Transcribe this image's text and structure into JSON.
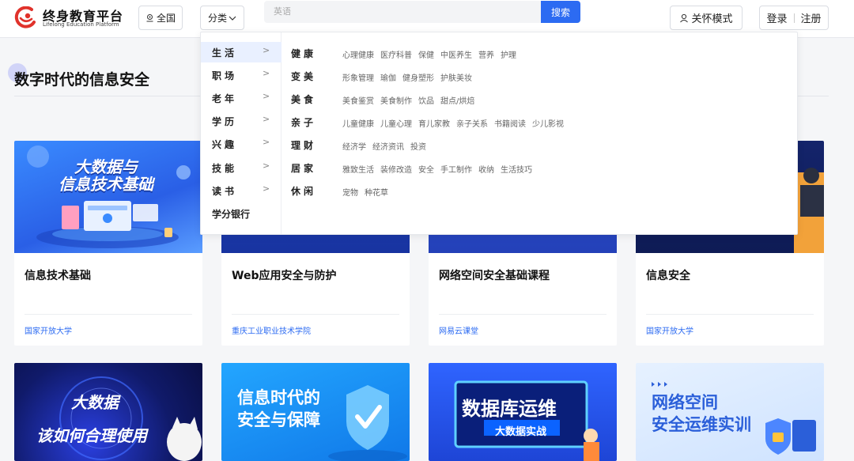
{
  "header": {
    "logo_title": "终身教育平台",
    "logo_sub": "Lifelong Education Platform",
    "region_label": "全国",
    "category_label": "分类",
    "search_placeholder": "英语",
    "search_button": "搜索",
    "care_mode": "关怀模式",
    "login": "登录",
    "register": "注册"
  },
  "section": {
    "title": "数字时代的信息安全"
  },
  "dropdown": {
    "left_items": [
      {
        "label": "生活",
        "arrow": ">"
      },
      {
        "label": "职场",
        "arrow": ">"
      },
      {
        "label": "老年",
        "arrow": ">"
      },
      {
        "label": "学历",
        "arrow": ">"
      },
      {
        "label": "兴趣",
        "arrow": ">"
      },
      {
        "label": "技能",
        "arrow": ">"
      },
      {
        "label": "读书",
        "arrow": ">"
      },
      {
        "label": "学分银行",
        "arrow": ""
      }
    ],
    "rows": [
      {
        "cat": "健康",
        "tags": [
          "心理健康",
          "医疗科普",
          "保健",
          "中医养生",
          "营养",
          "护理"
        ]
      },
      {
        "cat": "变美",
        "tags": [
          "形象管理",
          "瑜伽",
          "健身塑形",
          "护肤美妆"
        ]
      },
      {
        "cat": "美食",
        "tags": [
          "美食鉴赏",
          "美食制作",
          "饮品",
          "甜点/烘焙"
        ]
      },
      {
        "cat": "亲子",
        "tags": [
          "儿童健康",
          "儿童心理",
          "育儿家教",
          "亲子关系",
          "书籍阅读",
          "少儿影视"
        ]
      },
      {
        "cat": "理财",
        "tags": [
          "经济学",
          "经济资讯",
          "投资"
        ]
      },
      {
        "cat": "居家",
        "tags": [
          "雅致生活",
          "装修改造",
          "安全",
          "手工制作",
          "收纳",
          "生活技巧"
        ]
      },
      {
        "cat": "休闲",
        "tags": [
          "宠物",
          "种花草"
        ]
      }
    ]
  },
  "cards_row1": [
    {
      "title": "信息技术基础",
      "source": "国家开放大学",
      "banner": "大数据与\n信息技术基础"
    },
    {
      "title": "Web应用安全与防护",
      "source": "重庆工业职业技术学院"
    },
    {
      "title": "网络空间安全基础课程",
      "source": "网易云课堂"
    },
    {
      "title": "信息安全",
      "source": "国家开放大学"
    }
  ],
  "cards_row2": [
    {
      "banner1": "大数据",
      "banner2": "该如何合理使用"
    },
    {
      "banner1": "信息时代的",
      "banner2": "安全与保障"
    },
    {
      "banner1": "数据库运维",
      "banner2": "大数据实战"
    },
    {
      "banner1": "网络空间",
      "banner2": "安全运维实训"
    }
  ],
  "colors": {
    "accent": "#2c6bf2",
    "dropdown_active": "#e9f0ff",
    "logo_red": "#e0322b"
  }
}
